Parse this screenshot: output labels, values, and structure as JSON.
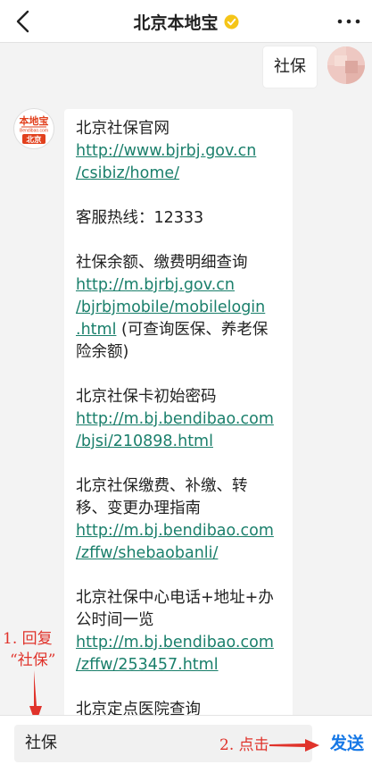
{
  "header": {
    "title": "北京本地宝",
    "back_icon": "back-chevron-icon",
    "verified_icon": "verified-badge-icon",
    "verified_color": "#f5c518",
    "more_icon": "more-dots-icon"
  },
  "conversation": {
    "user_message": "社保",
    "bot_avatar": {
      "logo_text": "本地宝",
      "site_text": "Bendibao.com",
      "city_text": "北京",
      "color": "#e2401d"
    },
    "bot_message": {
      "blocks": [
        {
          "title": "北京社保官网",
          "link_lines": [
            "http://www.bjrbj.gov.cn",
            "/csibiz/home/"
          ]
        },
        {
          "title": "客服热线：12333"
        },
        {
          "title": "社保余额、缴费明细查询",
          "link_lines": [
            "http://m.bjrbj.gov.cn",
            "/bjrbjmobile/mobilelogin",
            ".html"
          ],
          "note_tail": " (可查询医保、养老保",
          "note_line2": "险余额)"
        },
        {
          "title": "北京社保卡初始密码",
          "link_lines": [
            "http://m.bj.bendibao.com",
            "/bjsi/210898.html"
          ]
        },
        {
          "title_lines": [
            "北京社保缴费、补缴、转",
            "移、变更办理指南"
          ],
          "link_lines": [
            "http://m.bj.bendibao.com",
            "/zffw/shebaobanli/"
          ]
        },
        {
          "title_lines": [
            "北京社保中心电话+地址+办",
            "公时间一览"
          ],
          "link_lines": [
            "http://m.bj.bendibao.com",
            "/zffw/253457.html"
          ]
        },
        {
          "title": "北京定点医院查询"
        }
      ]
    }
  },
  "annotations": {
    "reply_step_line1": "1. 回复",
    "reply_step_line2": "“社保”",
    "click_step": "2. 点击",
    "color": "#e0332b"
  },
  "input_bar": {
    "input_value": "社保",
    "send_label": "发送",
    "send_color": "#1678e6"
  }
}
